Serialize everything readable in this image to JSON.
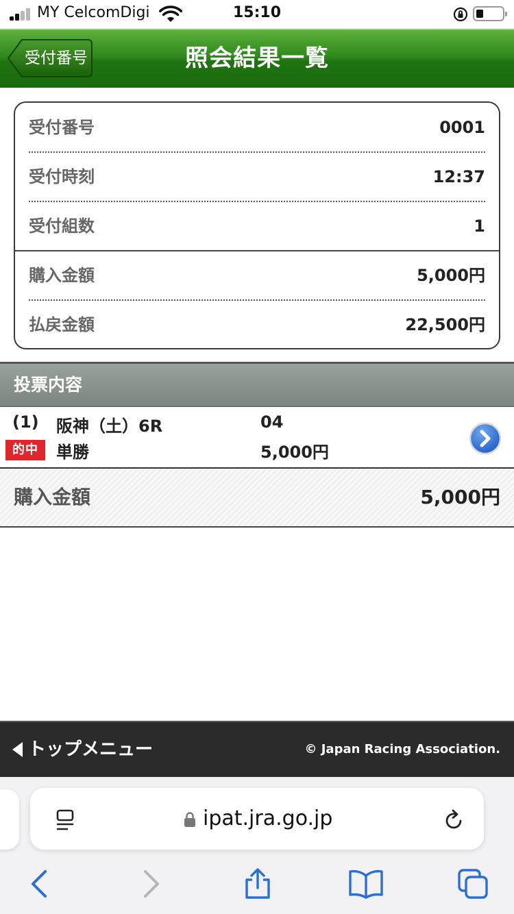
{
  "status_bar": {
    "carrier": "MY CelcomDigi",
    "time": "15:10"
  },
  "header": {
    "back_label": "受付番号",
    "title": "照会結果一覧"
  },
  "receipt": {
    "rows": [
      {
        "label": "受付番号",
        "value": "0001"
      },
      {
        "label": "受付時刻",
        "value": "12:37"
      },
      {
        "label": "受付組数",
        "value": "1"
      },
      {
        "label": "購入金額",
        "value": "5,000円"
      },
      {
        "label": "払戻金額",
        "value": "22,500円"
      }
    ]
  },
  "bet_section": {
    "title": "投票内容",
    "item": {
      "number": "(1)",
      "venue_race": "阪神（土）6R",
      "horse": "04",
      "result_badge": "的中",
      "bet_type": "単勝",
      "amount": "5,000円"
    },
    "total_label": "購入金額",
    "total_value": "5,000円"
  },
  "footer": {
    "menu_label": "トップメニュー",
    "copyright": "© Japan Racing Association."
  },
  "browser": {
    "url": "ipat.jra.go.jp"
  },
  "colors": {
    "header_green": "#2f8a1d",
    "hit_red": "#e0262a",
    "link_blue": "#2a6fd6",
    "footer_dark": "#2b2b2b"
  }
}
